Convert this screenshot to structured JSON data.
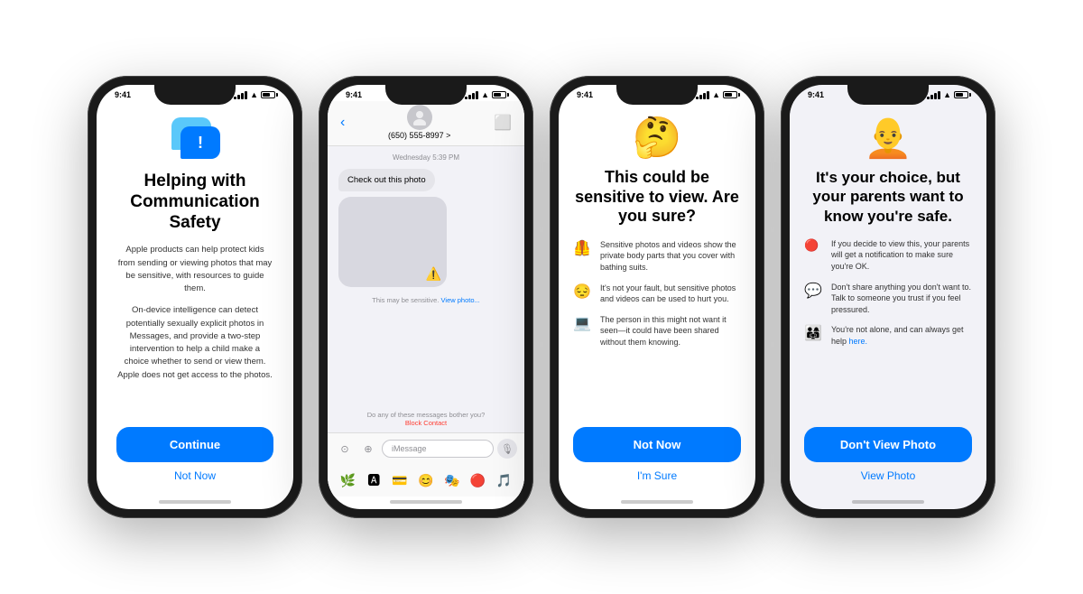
{
  "phone1": {
    "time": "9:41",
    "title": "Helping with Communication Safety",
    "desc1": "Apple products can help protect kids from sending or viewing photos that may be sensitive, with resources to guide them.",
    "desc2": "On-device intelligence can detect potentially sexually explicit photos in Messages, and provide a two-step intervention to help a child make a choice whether to send or view them. Apple does not get access to the photos.",
    "continue_label": "Continue",
    "not_now_label": "Not Now"
  },
  "phone2": {
    "time": "9:41",
    "contact_number": "(650) 555-8997 >",
    "date_label": "Wednesday 5:39 PM",
    "message_text": "Check out this photo",
    "sensitive_notice": "This may be sensitive.",
    "view_photo_label": "View photo...",
    "block_notice": "Do any of these messages bother you?",
    "block_label": "Block Contact",
    "input_placeholder": "iMessage"
  },
  "phone3": {
    "time": "9:41",
    "emoji": "🤔",
    "title": "This could be sensitive to view. Are you sure?",
    "items": [
      {
        "emoji": "🦺",
        "text": "Sensitive photos and videos show the private body parts that you cover with bathing suits."
      },
      {
        "emoji": "😔",
        "text": "It's not your fault, but sensitive photos and videos can be used to hurt you."
      },
      {
        "emoji": "💻",
        "text": "The person in this might not want it seen—it could have been shared without them knowing."
      }
    ],
    "not_now_label": "Not Now",
    "im_sure_label": "I'm Sure"
  },
  "phone4": {
    "time": "9:41",
    "emoji": "🧑‍🦲",
    "title": "It's your choice, but your parents want to know you're safe.",
    "items": [
      {
        "emoji": "🔴",
        "text": "If you decide to view this, your parents will get a notification to make sure you're OK."
      },
      {
        "emoji": "💬",
        "text": "Don't share anything you don't want to. Talk to someone you trust if you feel pressured."
      },
      {
        "emoji": "👨‍👩‍👧",
        "text": "You're not alone, and can always get help here."
      }
    ],
    "dont_view_label": "Don't View Photo",
    "view_photo_label": "View Photo",
    "here_label": "here."
  }
}
